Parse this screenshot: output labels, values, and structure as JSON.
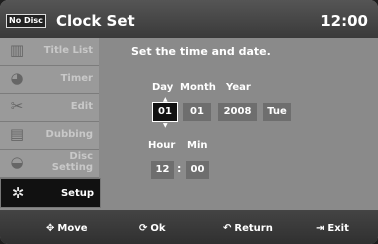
{
  "header": {
    "badge": "No Disc",
    "title": "Clock Set",
    "time": "12:00"
  },
  "sidebar": {
    "items": [
      {
        "label": "Title List",
        "icon": "film-icon",
        "glyph": "▥",
        "active": false
      },
      {
        "label": "Timer",
        "icon": "clock-icon",
        "glyph": "◕",
        "active": false
      },
      {
        "label": "Edit",
        "icon": "scissors-icon",
        "glyph": "✂",
        "active": false
      },
      {
        "label": "Dubbing",
        "icon": "copy-discs-icon",
        "glyph": "▤",
        "active": false
      },
      {
        "label": "Disc\nSetting",
        "label_line1": "Disc",
        "label_line2": "Setting",
        "icon": "disc-icon",
        "glyph": "◒",
        "active": false
      },
      {
        "label": "Setup",
        "icon": "gear-icon",
        "glyph": "✲",
        "active": true
      }
    ]
  },
  "main": {
    "instruction": "Set the time and date.",
    "date": {
      "day_label": "Day",
      "month_label": "Month",
      "year_label": "Year",
      "day": "01",
      "month": "01",
      "year": "2008",
      "weekday": "Tue"
    },
    "time": {
      "hour_label": "Hour",
      "min_label": "Min",
      "hour": "12",
      "sep": ":",
      "minute": "00"
    }
  },
  "footer": {
    "move": {
      "glyph": "✥",
      "label": "Move"
    },
    "ok": {
      "glyph": "⟳",
      "label": "Ok"
    },
    "return": {
      "glyph": "↶",
      "label": "Return"
    },
    "exit": {
      "glyph": "⇥",
      "label": "Exit"
    }
  },
  "colors": {
    "panel": "#8a8a8a",
    "header": "#444444",
    "selected": "#111111"
  }
}
